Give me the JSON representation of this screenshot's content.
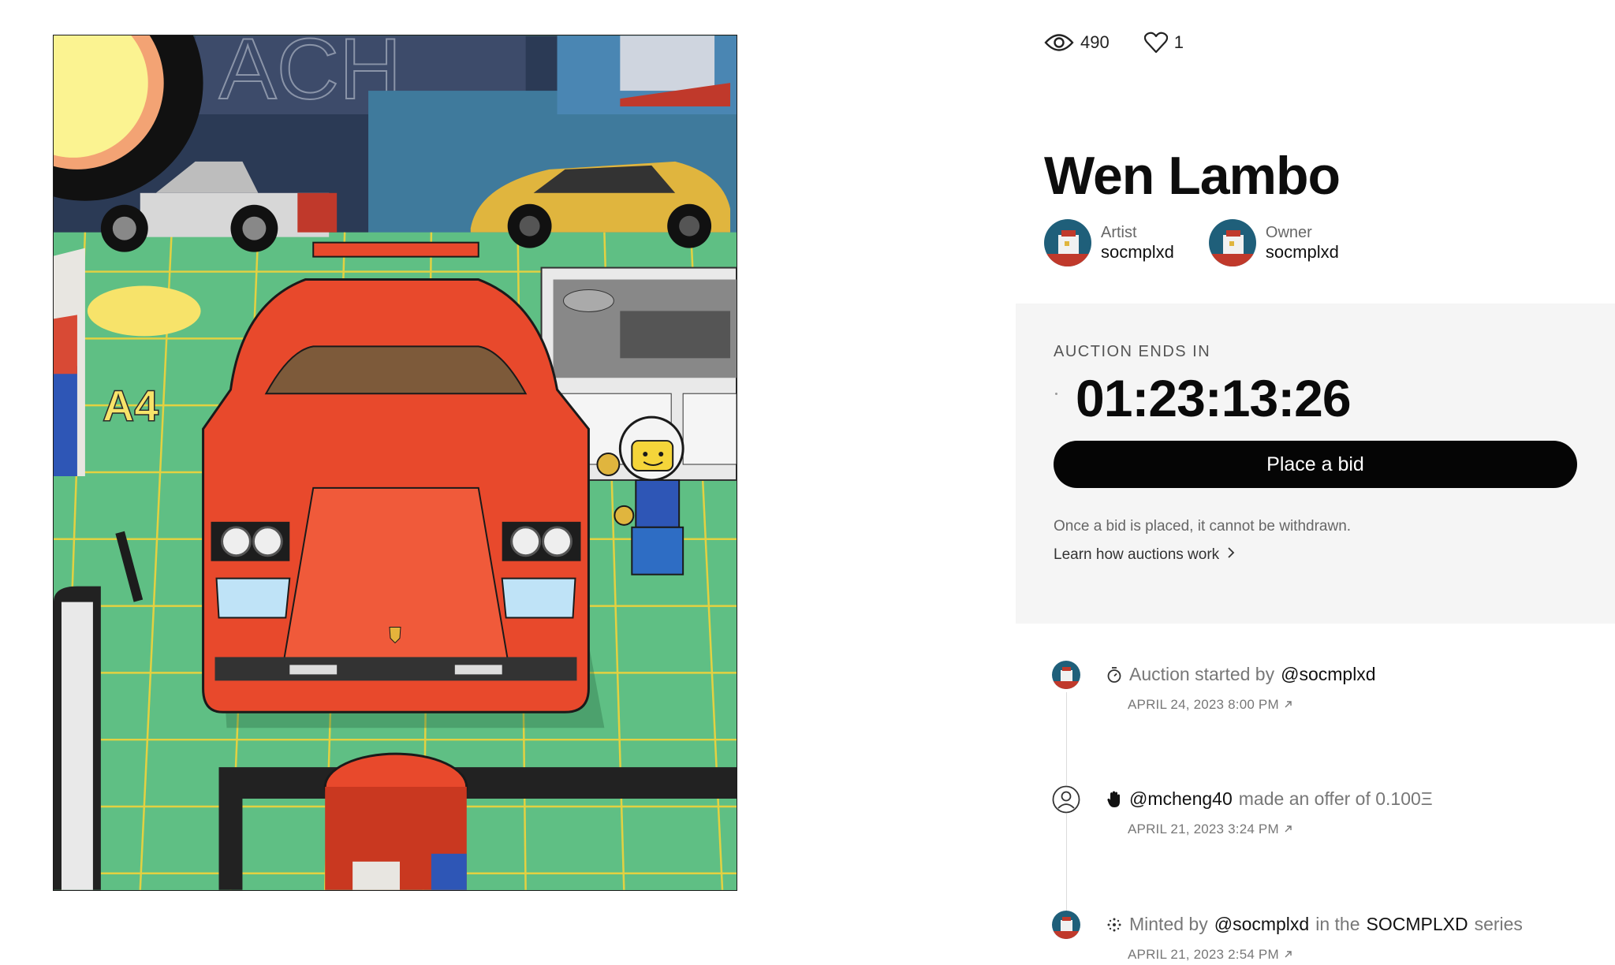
{
  "stats": {
    "views": "490",
    "likes": "1"
  },
  "title": "Wen Lambo",
  "artwork": {
    "tile_label": "A4",
    "sign_text": "ACH"
  },
  "people": [
    {
      "role": "Artist",
      "name": "socmplxd"
    },
    {
      "role": "Owner",
      "name": "socmplxd"
    }
  ],
  "auction": {
    "label": "AUCTION ENDS IN",
    "countdown": "01:23:13:26",
    "bid_button": "Place a bid",
    "note": "Once a bid is placed, it cannot be withdrawn.",
    "learn_link": "Learn how auctions work"
  },
  "history": [
    {
      "pre": "Auction started by",
      "user": "@socmplxd",
      "date": "APRIL 24, 2023 8:00 PM",
      "icon": "stopwatch-icon"
    },
    {
      "user": "@mcheng40",
      "mid": "made an offer of 0.100Ξ",
      "date": "APRIL 21, 2023 3:24 PM",
      "icon": "hand-icon"
    },
    {
      "pre": "Minted by",
      "user": "@socmplxd",
      "mid": "in the",
      "series": "SOCMPLXD",
      "post": "series",
      "date": "APRIL 21, 2023 2:54 PM",
      "icon": "sparkle-icon"
    }
  ],
  "colors": {
    "accent": "#050505",
    "panel": "#f5f5f5",
    "car": "#e8492c",
    "floor": "#5fbf84",
    "grid": "#f2d43a"
  }
}
